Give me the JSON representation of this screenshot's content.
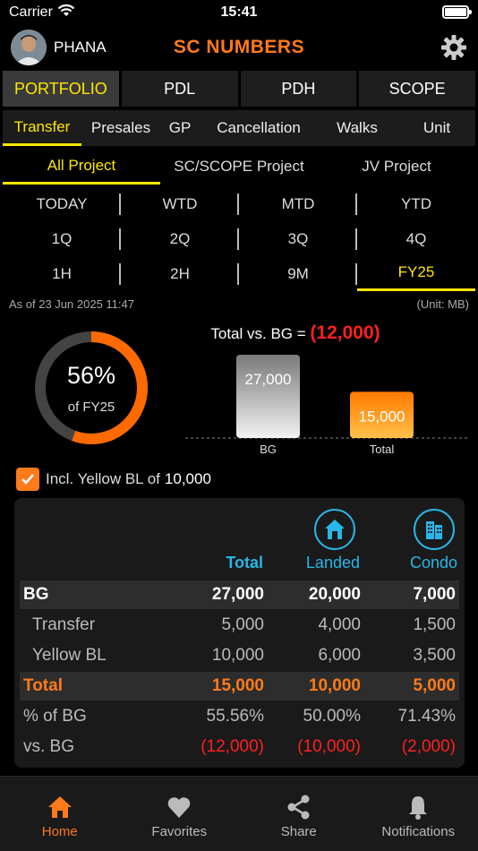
{
  "status": {
    "carrier": "Carrier",
    "time": "15:41"
  },
  "header": {
    "username": "PHANA",
    "title": "SC NUMBERS"
  },
  "main_tabs": [
    {
      "label": "PORTFOLIO",
      "active": true
    },
    {
      "label": "PDL"
    },
    {
      "label": "PDH"
    },
    {
      "label": "SCOPE"
    }
  ],
  "sub_tabs": [
    "Transfer",
    "Presales",
    "GP",
    "Cancellation",
    "Walks",
    "Unit"
  ],
  "project_tabs": [
    "All Project",
    "SC/SCOPE Project",
    "JV Project"
  ],
  "periods": [
    [
      "TODAY",
      "WTD",
      "MTD",
      "YTD"
    ],
    [
      "1Q",
      "2Q",
      "3Q",
      "4Q"
    ],
    [
      "1H",
      "2H",
      "9M",
      "FY25"
    ]
  ],
  "active_period": "FY25",
  "as_of": "As of 23 Jun 2025 11:47",
  "unit": "(Unit: MB)",
  "progress": {
    "pct_label": "56%",
    "sub_label": "of FY25",
    "fraction": 0.5556
  },
  "vs_bg": {
    "label": "Total vs. BG =",
    "value": "(12,000)"
  },
  "chart_data": {
    "type": "bar",
    "categories": [
      "BG",
      "Total"
    ],
    "values": [
      27000,
      15000
    ],
    "value_labels": [
      "27,000",
      "15,000"
    ],
    "colors": [
      "#bfbfbf",
      "#ff8a1a"
    ]
  },
  "incl": {
    "text": "Incl. Yellow BL of",
    "value": "10,000",
    "checked": true
  },
  "table": {
    "headers": {
      "total": "Total",
      "landed": "Landed",
      "condo": "Condo"
    },
    "rows": [
      {
        "label": "BG",
        "values": [
          "27,000",
          "20,000",
          "7,000"
        ]
      },
      {
        "label": "Transfer",
        "values": [
          "5,000",
          "4,000",
          "1,500"
        ]
      },
      {
        "label": "Yellow BL",
        "values": [
          "10,000",
          "6,000",
          "3,500"
        ]
      },
      {
        "label": "Total",
        "values": [
          "15,000",
          "10,000",
          "5,000"
        ]
      },
      {
        "label": "% of BG",
        "values": [
          "55.56%",
          "50.00%",
          "71.43%"
        ]
      },
      {
        "label": "vs. BG",
        "values": [
          "(12,000)",
          "(10,000)",
          "(2,000)"
        ]
      }
    ]
  },
  "nav": [
    "Home",
    "Favorites",
    "Share",
    "Notifications"
  ],
  "colors": {
    "accent": "#ff7a1a",
    "active_tab": "#ffe600",
    "negative": "#ff2020",
    "column_head": "#29b6e8"
  }
}
